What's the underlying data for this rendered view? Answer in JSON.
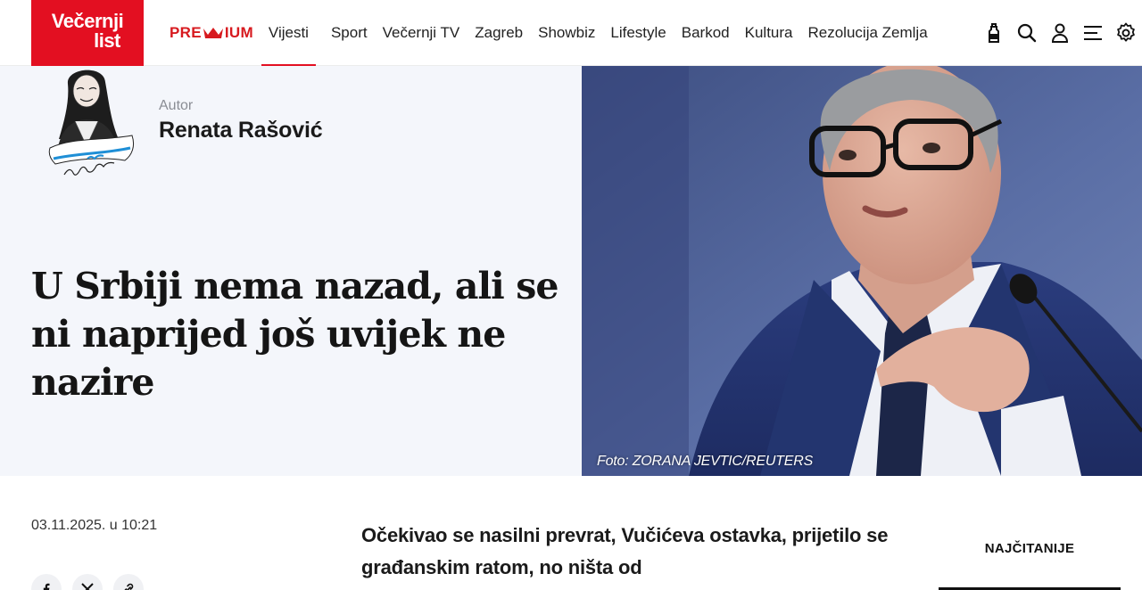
{
  "brand": {
    "name_line1": "Večernji",
    "name_line2": "list",
    "color": "#e30f21"
  },
  "nav": {
    "premium_prefix": "PRE",
    "premium_suffix": "IUM",
    "items": [
      "Vijesti",
      "Sport",
      "Večernji TV",
      "Zagreb",
      "Showbiz",
      "Lifestyle",
      "Barkod",
      "Kultura",
      "Rezolucija Zemlja"
    ],
    "active": "Vijesti"
  },
  "tools": [
    "bottle-icon",
    "search-icon",
    "user-icon",
    "menu-icon",
    "gear-icon"
  ],
  "author": {
    "role": "Autor",
    "name": "Renata Rašović"
  },
  "article": {
    "headline": "U Srbiji nema nazad, ali se ni naprijed još uvijek ne nazire",
    "photo_credit": "Foto: ZORANA JEVTIC/REUTERS",
    "date": "03.11.2025. u 10:21",
    "lead": "Očekivao se nasilni prevrat, Vučićeva ostavka, prijetilo se građanskim ratom, no ništa od"
  },
  "share": [
    "facebook-icon",
    "x-icon",
    "link-icon"
  ],
  "sidebar": {
    "most_read_title": "NAJČITANIJE"
  }
}
